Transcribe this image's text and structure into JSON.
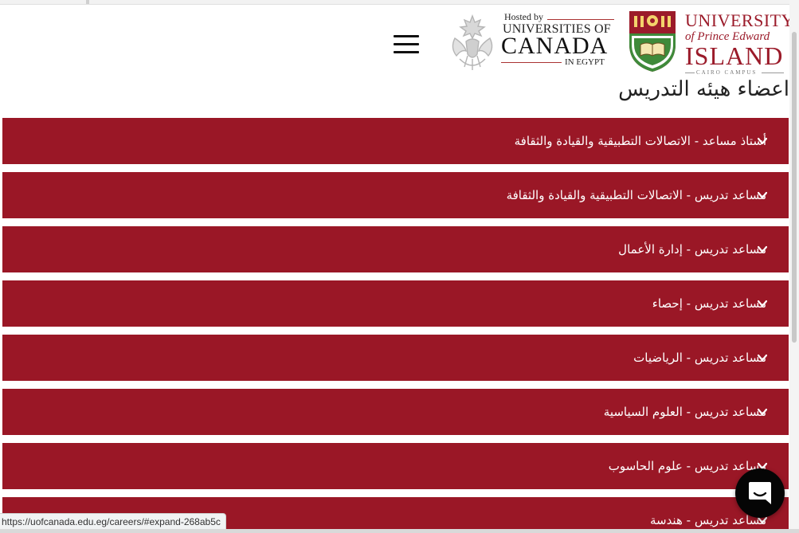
{
  "header": {
    "menu_icon": "hamburger-menu-icon",
    "uoc_logo": {
      "hosted_by": "Hosted by",
      "universities_of": "UNIVERSITIES OF",
      "canada": "CANADA",
      "in_egypt": "IN EGYPT",
      "emblem_icon": "eagle-maple-emblem-icon"
    },
    "upei_logo": {
      "university": "UNIVERSITY",
      "of_prince_edward": "of Prince Edward",
      "island": "ISLAND",
      "cairo_campus": "CAIRO CAMPUS",
      "crest_icon": "upei-crest-icon",
      "brand_color": "#9b1b2a"
    }
  },
  "page_title": "اعضاء هيئه التدريس",
  "accordion": {
    "color": "#9a1726",
    "chevron_icon": "chevron-down-icon",
    "items": [
      {
        "label": "أستاذ مساعد - الاتصالات التطبيقية والقيادة والثقافة"
      },
      {
        "label": "مساعد تدريس - الاتصالات التطبيقية والقيادة والثقافة"
      },
      {
        "label": "مساعد تدريس - إدارة الأعمال"
      },
      {
        "label": "مساعد تدريس - إحصاء"
      },
      {
        "label": "مساعد تدريس - الرياضيات"
      },
      {
        "label": "مساعد تدريس - العلوم السياسية"
      },
      {
        "label": "مساعد تدريس - علوم الحاسوب"
      },
      {
        "label": "مساعد تدريس - هندسة"
      }
    ]
  },
  "chat": {
    "icon": "chat-bubble-icon"
  },
  "status_bar": {
    "url": "https://uofcanada.edu.eg/careers/#expand-268ab5c"
  }
}
